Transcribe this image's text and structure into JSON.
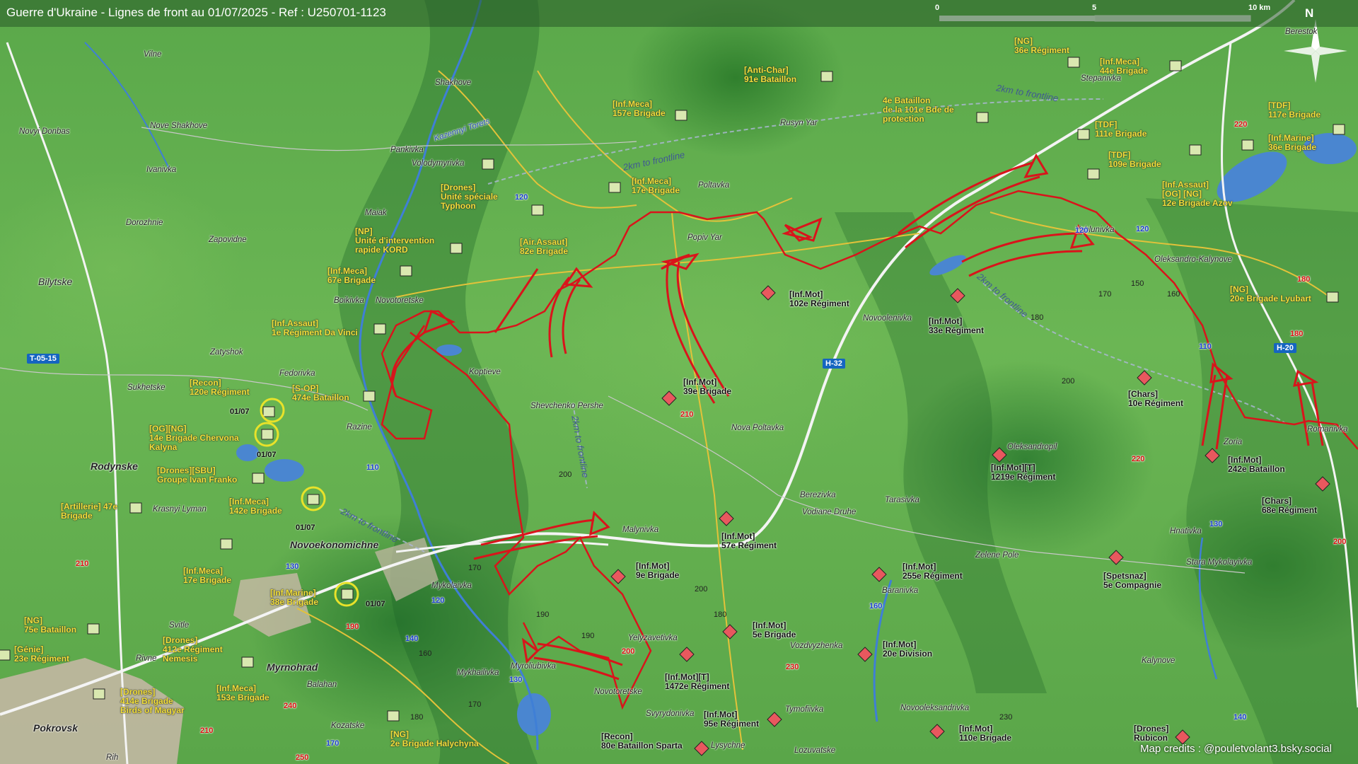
{
  "title": "Guerre d'Ukraine - Lignes de front au 01/07/2025 - Ref : U250701-1123",
  "scale": {
    "labels": [
      "0",
      "5",
      "10 km"
    ]
  },
  "north_label": "N",
  "credits": "Map credits : @pouletvolant3.bsky.social",
  "colors": {
    "front": "#d9141b",
    "road_badge": "#1565c0",
    "unit_text": "#f3e03a",
    "ru_symbol": "#e8585e",
    "ua_symbol": "#d9e8b0"
  },
  "places": [
    {
      "name": "Vilne"
    },
    {
      "name": "Novyi Donbas"
    },
    {
      "name": "Nove Shakhove"
    },
    {
      "name": "Ivanivka"
    },
    {
      "name": "Dorozhnie"
    },
    {
      "name": "Zapovidne"
    },
    {
      "name": "Bilytske"
    },
    {
      "name": "Zatyshok"
    },
    {
      "name": "Sukhetske"
    },
    {
      "name": "Fedorivka"
    },
    {
      "name": "Rodynske"
    },
    {
      "name": "Krasnyi Lyman"
    },
    {
      "name": "Novoekonomichne"
    },
    {
      "name": "Myrnohrad"
    },
    {
      "name": "Pokrovsk"
    },
    {
      "name": "Rih"
    },
    {
      "name": "Shakhove"
    },
    {
      "name": "Pankivka"
    },
    {
      "name": "Volodymyrivka"
    },
    {
      "name": "Maiak"
    },
    {
      "name": "Boikivka"
    },
    {
      "name": "Novotoretske"
    },
    {
      "name": "Koptieve"
    },
    {
      "name": "Razine"
    },
    {
      "name": "Shevchenko Pershe"
    },
    {
      "name": "Malynivka"
    },
    {
      "name": "Mykolaivka"
    },
    {
      "name": "Mykhailivka"
    },
    {
      "name": "Myroliubivka"
    },
    {
      "name": "Novotoretske"
    },
    {
      "name": "Yelyzavetivka"
    },
    {
      "name": "Svyrydonivka"
    },
    {
      "name": "Lysychne"
    },
    {
      "name": "Tymofiivka"
    },
    {
      "name": "Lozuvatske"
    },
    {
      "name": "Kozatske"
    },
    {
      "name": "Balahan"
    },
    {
      "name": "Rivne"
    },
    {
      "name": "Svitle"
    },
    {
      "name": "Poltavka"
    },
    {
      "name": "Popiv Yar"
    },
    {
      "name": "Rusyn Yar"
    },
    {
      "name": "Nova Poltavka"
    },
    {
      "name": "Berezivka"
    },
    {
      "name": "Vodiane Druhe"
    },
    {
      "name": "Tarasivka"
    },
    {
      "name": "Zelene Pole"
    },
    {
      "name": "Baranivka"
    },
    {
      "name": "Vozdvyzhenka"
    },
    {
      "name": "Novooleksandrivka"
    },
    {
      "name": "Novoolenivka"
    },
    {
      "name": "Oleksandropil"
    },
    {
      "name": "Yablunivka"
    },
    {
      "name": "Oleksandro-Kalynove"
    },
    {
      "name": "Stepanivka"
    },
    {
      "name": "Berestok"
    },
    {
      "name": "Zoria"
    },
    {
      "name": "Romanivka"
    },
    {
      "name": "Hnativka"
    },
    {
      "name": "Stara Mykolayivka"
    },
    {
      "name": "Kalynove"
    },
    {
      "name": "Kazennyi Torets"
    }
  ],
  "road_badges": [
    "T-05-15",
    "H-32",
    "H-20"
  ],
  "road_numbers_red": [
    "210",
    "190",
    "240",
    "250",
    "210",
    "200",
    "230",
    "210",
    "220",
    "200",
    "180",
    "180",
    "220"
  ],
  "road_numbers_blue": [
    "120",
    "120",
    "110",
    "130",
    "120",
    "140",
    "130",
    "160",
    "170",
    "110",
    "130",
    "140",
    "120"
  ],
  "contours": [
    "200",
    "170",
    "190",
    "180",
    "200",
    "190",
    "160",
    "170",
    "150",
    "160",
    "170",
    "180",
    "200",
    "230",
    "180"
  ],
  "front_labels": [
    "2km to frontline",
    "2km to frontline",
    "2km to frontline",
    "2km to frontline",
    "2km to frontline"
  ],
  "units_ua": [
    {
      "label": "[NG]\n36e Régiment"
    },
    {
      "label": "[Inf.Meca]\n44e Brigade"
    },
    {
      "label": "[Anti-Char]\n91e Bataillon"
    },
    {
      "label": "[Inf.Meca]\n157e Brigade"
    },
    {
      "label": "4e Bataillon\nde la 101e Bde de\nprotection"
    },
    {
      "label": "[TDF]\n111e Brigade"
    },
    {
      "label": "[TDF]\n117e Brigade"
    },
    {
      "label": "[TDF]\n109e Brigade"
    },
    {
      "label": "[Inf.Marine]\n36e Brigade"
    },
    {
      "label": "[Inf.Assaut]\n[OG] [NG]\n12e Brigade Azov"
    },
    {
      "label": "[Drones]\nUnité spéciale\nTyphoon"
    },
    {
      "label": "[Inf.Meca]\n17e Brigade"
    },
    {
      "label": "[Air.Assaut]\n82e Brigade"
    },
    {
      "label": "[NP]\nUnité d'intervention\nrapide KORD"
    },
    {
      "label": "[Inf.Meca]\n67e Brigade"
    },
    {
      "label": "[Inf.Assaut]\n1e Régiment Da Vinci"
    },
    {
      "label": "[Recon]\n120e Régiment"
    },
    {
      "label": "[S-OP]\n474e Bataillon"
    },
    {
      "label": "[OG][NG]\n14e Brigade Chervona\nKalyna"
    },
    {
      "label": "[Drones][SBU]\nGroupe Ivan Franko"
    },
    {
      "label": "[Artillerie] 47e\nBrigade"
    },
    {
      "label": "[Inf.Meca]\n142e Brigade"
    },
    {
      "label": "[Inf.Meca]\n17e Brigade"
    },
    {
      "label": "[Inf.Marine]\n38e Brigade"
    },
    {
      "label": "[NG]\n75e Bataillon"
    },
    {
      "label": "[Génie]\n23e Régiment"
    },
    {
      "label": "[Drones]\n412e Régiment\nNemesis"
    },
    {
      "label": "[Inf.Meca]\n153e Brigade"
    },
    {
      "label": "[Drones]\n414e Brigade\nBirds of Magyar"
    },
    {
      "label": "[NG]\n2e Brigade Halychyna"
    },
    {
      "label": "[NG]\n20e Brigade Lyubart"
    }
  ],
  "units_ru": [
    {
      "label": "[Inf.Mot]\n102e Régiment"
    },
    {
      "label": "[Inf.Mot]\n33e Régiment"
    },
    {
      "label": "[Inf.Mot]\n39e Brigade"
    },
    {
      "label": "[Chars]\n10e Régiment"
    },
    {
      "label": "[Inf.Mot][T]\n1219e Régiment"
    },
    {
      "label": "[Inf.Mot]\n242e Bataillon"
    },
    {
      "label": "[Chars]\n68e Régiment"
    },
    {
      "label": "[Inf.Mot]\n57e Régiment"
    },
    {
      "label": "[Inf.Mot]\n9e Brigade"
    },
    {
      "label": "[Inf.Mot]\n255e Régiment"
    },
    {
      "label": "[Spetsnaz]\n5e Compagnie"
    },
    {
      "label": "[Inf.Mot]\n5e Brigade"
    },
    {
      "label": "[Inf.Mot]\n20e Division"
    },
    {
      "label": "[Inf.Mot][T]\n1472e Régiment"
    },
    {
      "label": "[Inf.Mot]\n95e Régiment"
    },
    {
      "label": "[Recon]\n80e Bataillon Sparta"
    },
    {
      "label": "[Inf.Mot]\n110e Brigade"
    },
    {
      "label": "[Drones]\nRubicon"
    }
  ],
  "dates": [
    "01/07",
    "01/07",
    "01/07",
    "01/07"
  ]
}
